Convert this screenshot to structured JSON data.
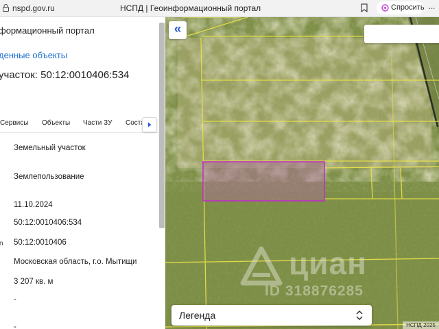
{
  "browser": {
    "url": "nspd.gov.ru",
    "page_title": "НСПД | Геоинформационный портал",
    "ask_label": "Спросить",
    "more_label": "···"
  },
  "panel": {
    "portal_title": "формационный портал",
    "found_link": "денные объекты",
    "plot_title": "участок: 50:12:0010406:534",
    "tabs": [
      "Сервисы",
      "Объекты",
      "Части ЗУ",
      "Соста"
    ],
    "rows": [
      {
        "label": "",
        "value": "Земельный участок"
      },
      {
        "label": "",
        "value": "Землепользование"
      },
      {
        "label": "",
        "value": "11.10.2024"
      },
      {
        "label": "",
        "value": "50:12:0010406:534"
      },
      {
        "label": "n",
        "value": "50:12:0010406"
      },
      {
        "label": "",
        "value": "Московская область, г.о. Мытищи"
      },
      {
        "label": "",
        "value": "3 207 кв. м"
      },
      {
        "label": "",
        "value": "-"
      },
      {
        "label": "",
        "value": "-"
      }
    ]
  },
  "map": {
    "legend_label": "Легенда",
    "credit": "НСПД 2025",
    "watermark_word": "циан",
    "watermark_id": "ID 318876285",
    "colors": {
      "parcel_lines": "#e8e04a",
      "selected_parcel": "#c02ec8",
      "accent": "#2c5fd4"
    }
  }
}
